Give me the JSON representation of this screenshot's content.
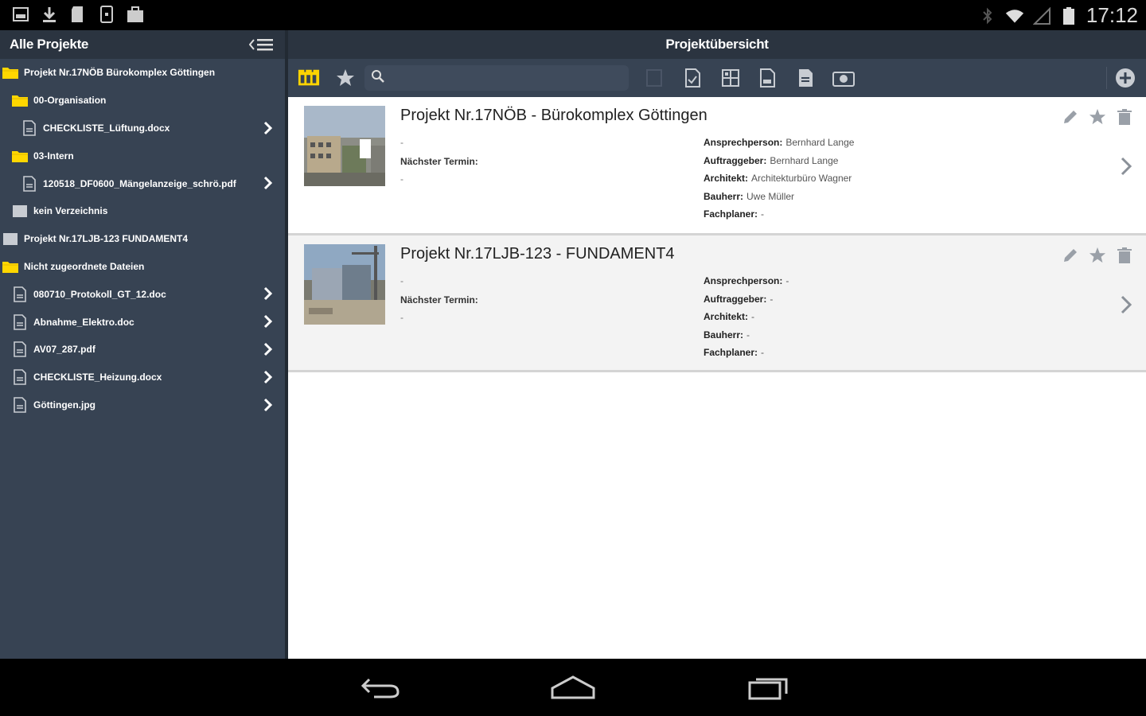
{
  "status_bar": {
    "time": "17:12",
    "left_icons": [
      "image-icon",
      "download-icon",
      "sd-card-icon",
      "phone-icon",
      "bag-icon"
    ],
    "right_icons": [
      "bluetooth-icon",
      "wifi-icon",
      "signal-icon",
      "battery-icon"
    ]
  },
  "sidebar": {
    "title": "Alle Projekte",
    "items": [
      {
        "label": "Projekt Nr.17NÖB Bürokomplex Göttingen",
        "type": "folder-open",
        "level": 0,
        "chevron": false
      },
      {
        "label": "00-Organisation",
        "type": "folder-open",
        "level": 1,
        "chevron": false
      },
      {
        "label": "CHECKLISTE_Lüftung.docx",
        "type": "file",
        "level": 2,
        "chevron": true
      },
      {
        "label": "03-Intern",
        "type": "folder-open",
        "level": 1,
        "chevron": false
      },
      {
        "label": "120518_DF0600_Mängelanzeige_schrö.pdf",
        "type": "file",
        "level": 2,
        "chevron": true
      },
      {
        "label": "kein Verzeichnis",
        "type": "folder-closed",
        "level": 1,
        "chevron": false
      },
      {
        "label": "Projekt Nr.17LJB-123 FUNDAMENT4",
        "type": "folder-closed",
        "level": 0,
        "chevron": false
      },
      {
        "label": "Nicht zugeordnete Dateien",
        "type": "folder-open",
        "level": 0,
        "chevron": false
      },
      {
        "label": "080710_Protokoll_GT_12.doc",
        "type": "file",
        "level": 1,
        "chevron": true
      },
      {
        "label": "Abnahme_Elektro.doc",
        "type": "file",
        "level": 1,
        "chevron": true
      },
      {
        "label": "AV07_287.pdf",
        "type": "file",
        "level": 1,
        "chevron": true
      },
      {
        "label": "CHECKLISTE_Heizung.docx",
        "type": "file",
        "level": 1,
        "chevron": true
      },
      {
        "label": "Göttingen.jpg",
        "type": "file",
        "level": 1,
        "chevron": true
      }
    ]
  },
  "main": {
    "title": "Projektübersicht",
    "search": {
      "value": "",
      "placeholder": ""
    },
    "projects": [
      {
        "title": "Projekt Nr.17NÖB - Bürokomplex Göttingen",
        "dash1": "-",
        "next_label": "Nächster Termin:",
        "dash2": "-",
        "props": [
          {
            "k": "Ansprechperson:",
            "v": "Bernhard Lange"
          },
          {
            "k": "Auftraggeber:",
            "v": "Bernhard Lange"
          },
          {
            "k": "Architekt:",
            "v": "Architekturbüro Wagner"
          },
          {
            "k": "Bauherr:",
            "v": "Uwe Müller"
          },
          {
            "k": "Fachplaner:",
            "v": "-"
          }
        ]
      },
      {
        "title": "Projekt Nr.17LJB-123 - FUNDAMENT4",
        "dash1": "-",
        "next_label": "Nächster Termin:",
        "dash2": "-",
        "props": [
          {
            "k": "Ansprechperson:",
            "v": "-"
          },
          {
            "k": "Auftraggeber:",
            "v": "-"
          },
          {
            "k": "Architekt:",
            "v": "-"
          },
          {
            "k": "Bauherr:",
            "v": "-"
          },
          {
            "k": "Fachplaner:",
            "v": "-"
          }
        ]
      }
    ]
  },
  "colors": {
    "folder": "#ffd700",
    "accent": "#ffd400",
    "sidebar_bg": "#374353",
    "header_bg": "#2b3440"
  }
}
